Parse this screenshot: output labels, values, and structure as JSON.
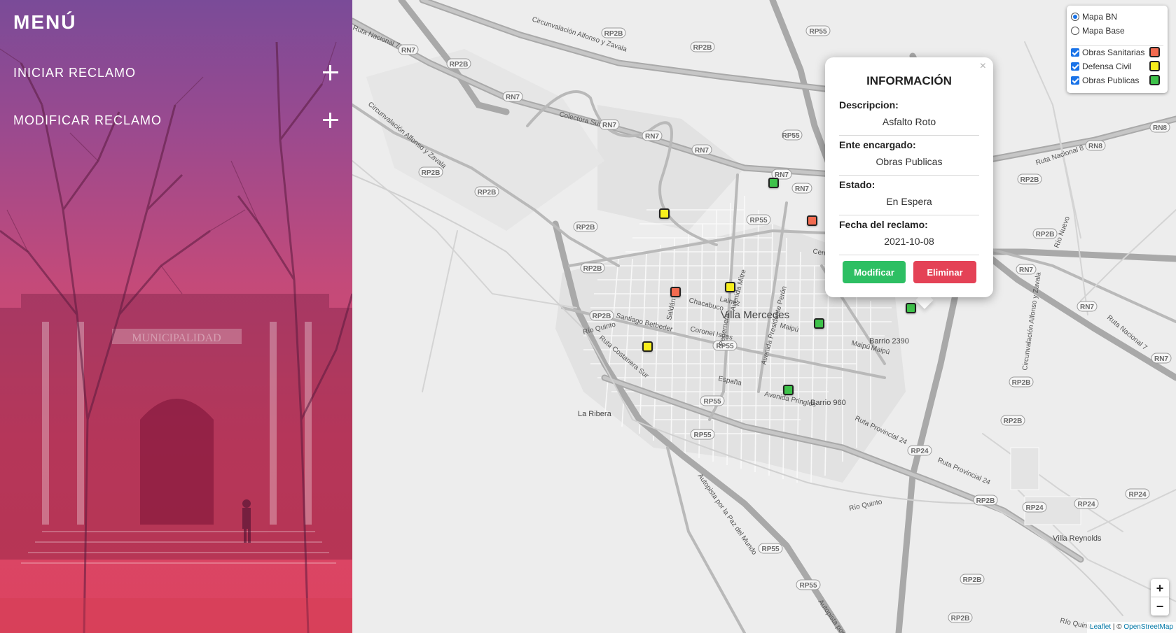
{
  "sidebar": {
    "title": "MENÚ",
    "items": [
      {
        "label": "INICIAR RECLAMO"
      },
      {
        "label": "MODIFICAR RECLAMO"
      }
    ],
    "photo_sign": "MUNICIPALIDAD"
  },
  "map": {
    "place_labels": {
      "city": "Villa Mercedes",
      "barrio_2390": "Barrio 2390",
      "barrio_960": "Barrio 960",
      "la_ribera": "La Ribera",
      "villa_reynolds": "Villa Reynolds"
    },
    "street_labels": {
      "ruta_nacional_7": "Ruta Nacional 7",
      "circunvalacion_top": "Circunvalación Alfonso y Zavala",
      "circunvalacion_west": "Circunvalación Alfonso y Zavala",
      "circunvalacion_east": "Circunvalación Alfonso y Zavala",
      "colectora_sur": "Colectora Sur",
      "santiago_betbeder": "Santiago Betbeder",
      "coronel_iseas": "Coronel Iseas",
      "chacabuco": "Chacabuco",
      "lainez": "Lainez",
      "avenida_mitre": "Avenida Mitre",
      "pedernera": "Pedernera",
      "avenida_presidente_peron": "Avenida Presidente Perón",
      "maipu_1": "Maipú",
      "maipu_2": "Maipú",
      "maipu_3": "Maipú",
      "espana": "España",
      "avenida_pringles": "Avenida Pringles",
      "ruta_costanera_sur": "Ruta Costanera Sur",
      "ruta_provincial_24a": "Ruta Provincial 24",
      "ruta_provincial_24b": "Ruta Provincial 24",
      "autopista_paz": "Autopista por la Paz del Mundo",
      "autopista_paz_2": "Autopista por la P",
      "ruta_nacional_8": "Ruta Nacional 8",
      "ruta_nacional_7_east": "Ruta Nacional 7",
      "rio_quinto_1": "Río Quinto",
      "rio_quinto_2": "Río Quinto",
      "rio_nuevo": "Río Nuevo",
      "central": "Cent",
      "saldan": "Saldán",
      "rio_quinto_3": "Río Quinto"
    },
    "shields": [
      "RN7",
      "RP2B",
      "RP55",
      "RN8",
      "RP24"
    ],
    "markers": [
      {
        "layer": "Obras Publicas"
      },
      {
        "layer": "Defensa Civil"
      },
      {
        "layer": "Obras Sanitarias"
      },
      {
        "layer": "Defensa Civil"
      },
      {
        "layer": "Obras Sanitarias"
      },
      {
        "layer": "Obras Publicas"
      },
      {
        "layer": "Obras Publicas"
      },
      {
        "layer": "Defensa Civil"
      },
      {
        "layer": "Obras Publicas"
      }
    ],
    "colors": {
      "obras_sanitarias": "#f26b50",
      "defensa_civil": "#f7ee1c",
      "obras_publicas": "#3ec24a",
      "modificar_button": "#2dbf63",
      "eliminar_button": "#e44256",
      "sidebar_top": "#7a4b98",
      "sidebar_bottom": "#dc4460"
    }
  },
  "popup": {
    "close": "×",
    "title": "INFORMACIÓN",
    "fields": [
      {
        "label": "Descripcion:",
        "value": "Asfalto Roto"
      },
      {
        "label": "Ente encargado:",
        "value": "Obras Publicas"
      },
      {
        "label": "Estado:",
        "value": "En Espera"
      },
      {
        "label": "Fecha del reclamo:",
        "value": "2021-10-08"
      }
    ],
    "modify_label": "Modificar",
    "delete_label": "Eliminar"
  },
  "layers": {
    "base": [
      {
        "label": "Mapa BN",
        "selected": true
      },
      {
        "label": "Mapa Base",
        "selected": false
      }
    ],
    "overlays": [
      {
        "label": "Obras Sanitarias",
        "checked": true,
        "color": "#f26b50"
      },
      {
        "label": "Defensa Civil",
        "checked": true,
        "color": "#f7ee1c"
      },
      {
        "label": "Obras Publicas",
        "checked": true,
        "color": "#3ec24a"
      }
    ]
  },
  "zoom": {
    "in": "+",
    "out": "−"
  },
  "attribution": {
    "leaflet": "Leaflet",
    "separator": " | © ",
    "osm": "OpenStreetMap"
  }
}
